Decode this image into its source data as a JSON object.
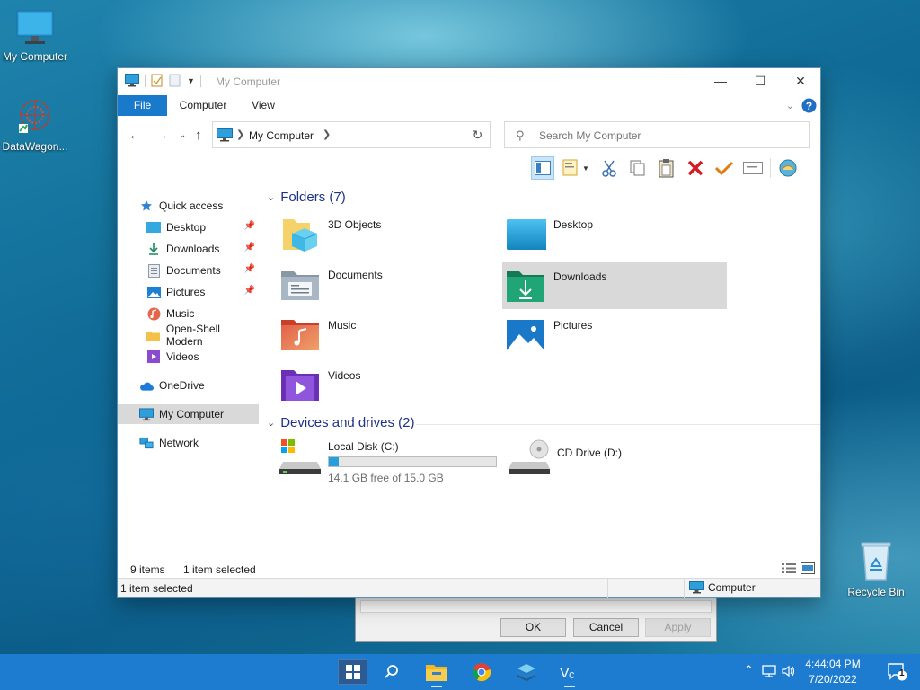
{
  "desktop": {
    "icons": [
      {
        "label": "My Computer",
        "icon": "computer-icon"
      },
      {
        "label": "DataWagon...",
        "icon": "datawagon-icon"
      },
      {
        "label": "Recycle Bin",
        "icon": "recycle-bin-icon"
      }
    ]
  },
  "background_dialog": {
    "ok_label": "OK",
    "cancel_label": "Cancel",
    "apply_label": "Apply"
  },
  "window": {
    "title": "My Computer",
    "controls": {
      "minimize": "—",
      "maximize": "☐",
      "close": "✕"
    },
    "ribbon_tabs": [
      "File",
      "Computer",
      "View"
    ],
    "address": {
      "crumb": "My Computer",
      "search_placeholder": "Search My Computer"
    },
    "toolbar_icons": [
      "layout-icon",
      "properties-icon",
      "cut-icon",
      "copy-icon",
      "paste-icon",
      "delete-icon",
      "checkmark-icon",
      "rename-icon",
      "shell-icon"
    ],
    "nav": {
      "quick_access": "Quick access",
      "quick_items": [
        {
          "label": "Desktop",
          "pinned": true
        },
        {
          "label": "Downloads",
          "pinned": true
        },
        {
          "label": "Documents",
          "pinned": true
        },
        {
          "label": "Pictures",
          "pinned": true
        },
        {
          "label": "Music",
          "pinned": false
        },
        {
          "label": "Open-Shell Modern",
          "pinned": false
        },
        {
          "label": "Videos",
          "pinned": false
        }
      ],
      "onedrive": "OneDrive",
      "my_computer": "My Computer",
      "network": "Network"
    },
    "content": {
      "folders_header": "Folders (7)",
      "folders": [
        {
          "name": "3D Objects",
          "icon": "3d-objects-folder-icon"
        },
        {
          "name": "Desktop",
          "icon": "desktop-folder-icon"
        },
        {
          "name": "Documents",
          "icon": "documents-folder-icon"
        },
        {
          "name": "Downloads",
          "icon": "downloads-folder-icon"
        },
        {
          "name": "Music",
          "icon": "music-folder-icon"
        },
        {
          "name": "Pictures",
          "icon": "pictures-folder-icon"
        },
        {
          "name": "Videos",
          "icon": "videos-folder-icon"
        }
      ],
      "devices_header": "Devices and drives (2)",
      "drives": [
        {
          "name": "Local Disk (C:)",
          "free_text": "14.1 GB free of 15.0 GB",
          "used_fraction": 0.06
        },
        {
          "name": "CD Drive (D:)"
        }
      ]
    },
    "status": {
      "items_count": "9 items",
      "selected_count": "1 item selected",
      "bar_left": "1 item selected",
      "bar_right": "Computer"
    }
  },
  "taskbar": {
    "time": "4:44:04 PM",
    "date": "7/20/2022",
    "notification_count": "1",
    "icons": [
      "start-icon",
      "search-icon",
      "file-explorer-icon",
      "chrome-icon",
      "stack-app-icon",
      "vc-app-icon"
    ]
  },
  "colors": {
    "accent": "#1979ca",
    "taskbar": "#1d7ccf",
    "selection": "#d9d9d9",
    "group_header": "#1e3287",
    "drive_fill": "#26a0da"
  }
}
